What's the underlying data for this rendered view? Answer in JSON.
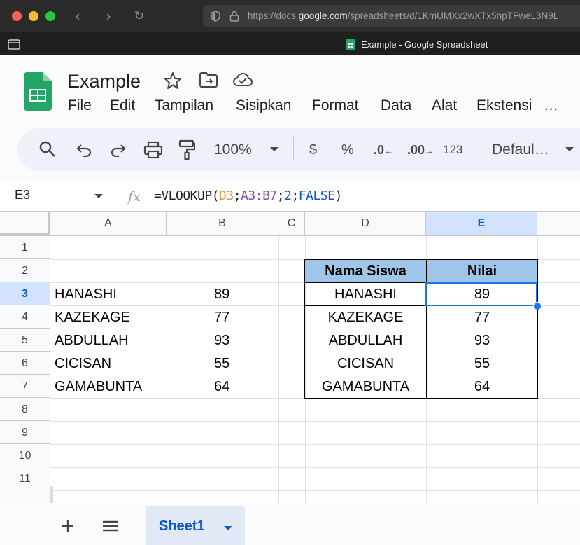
{
  "browser": {
    "url_prefix": "https://docs.",
    "url_domain": "google.com",
    "url_path": "/spreadsheets/d/1KmUMXx2wXTx5npTFweL3N9L",
    "tab_title": "Example - Google Spreadsheet",
    "colors": {
      "close": "#ff5f57",
      "minimize": "#febc2e",
      "maximize": "#28c840"
    }
  },
  "app": {
    "title": "Example",
    "menu": [
      "File",
      "Edit",
      "Tampilan",
      "Sisipkan",
      "Format",
      "Data",
      "Alat",
      "Ekstensi",
      "…"
    ]
  },
  "toolbar": {
    "zoom": "100%",
    "currency": "$",
    "percent": "%",
    "dec_decrease": ".0",
    "dec_increase": ".00",
    "number_format": "123",
    "font": "Defaul…"
  },
  "formula_bar": {
    "cell_ref": "E3",
    "formula_parts": {
      "fn": "=VLOOKUP(",
      "arg1": "D3",
      "sep1": ";",
      "arg2": "A3:B7",
      "sep2": ";",
      "arg3": "2",
      "sep3": ";",
      "arg4": "FALSE",
      "close": ")"
    }
  },
  "sheet": {
    "columns": [
      "A",
      "B",
      "C",
      "D",
      "E"
    ],
    "rows": [
      "1",
      "2",
      "3",
      "4",
      "5",
      "6",
      "7",
      "8",
      "9",
      "10",
      "11"
    ],
    "selected_col": "E",
    "selected_row": "3",
    "source": [
      {
        "name": "HANASHI",
        "score": "89"
      },
      {
        "name": "KAZEKAGE",
        "score": "77"
      },
      {
        "name": "ABDULLAH",
        "score": "93"
      },
      {
        "name": "CICISAN",
        "score": "55"
      },
      {
        "name": "GAMABUNTA",
        "score": "64"
      }
    ],
    "lookup_table": {
      "headers": [
        "Nama Siswa",
        "Nilai"
      ],
      "rows": [
        {
          "name": "HANASHI",
          "score": "89"
        },
        {
          "name": "KAZEKAGE",
          "score": "77"
        },
        {
          "name": "ABDULLAH",
          "score": "93"
        },
        {
          "name": "CICISAN",
          "score": "55"
        },
        {
          "name": "GAMABUNTA",
          "score": "64"
        }
      ],
      "header_color": "#9fc5e8"
    }
  },
  "bottom": {
    "sheet_tab": "Sheet1"
  }
}
